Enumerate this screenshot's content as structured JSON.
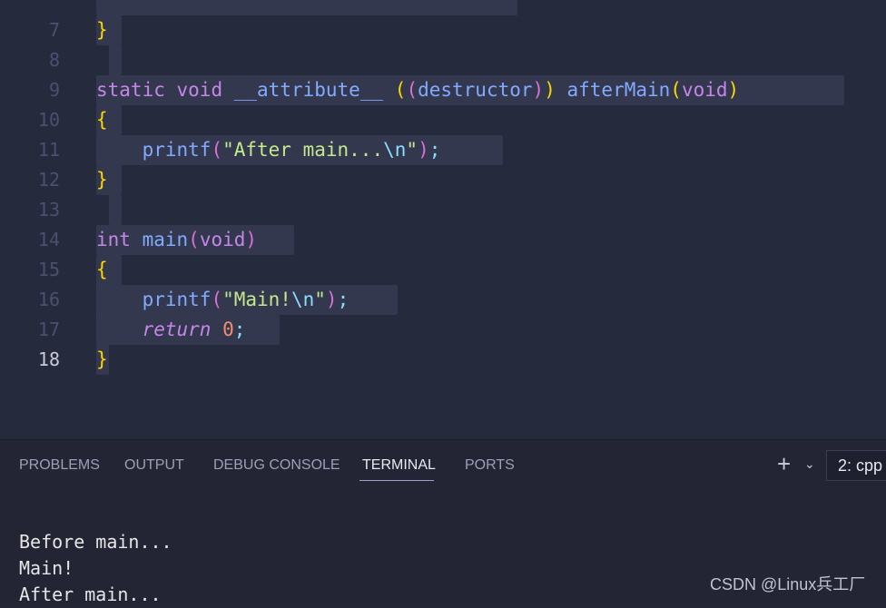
{
  "editor": {
    "lines": {
      "l7": "7",
      "l8": "8",
      "l9": "9",
      "l10": "10",
      "l11": "11",
      "l12": "12",
      "l13": "13",
      "l14": "14",
      "l15": "15",
      "l16": "16",
      "l17": "17",
      "l18": "18"
    },
    "code": {
      "static": "static",
      "void": "void",
      "attribute": "__attribute__",
      "destructor": "destructor",
      "afterMain": "afterMain",
      "printf": "printf",
      "after_str": "\"After main...",
      "newline": "\\n",
      "quote": "\"",
      "int": "int",
      "main": "main",
      "main_str": "\"Main!",
      "return": "return",
      "zero": "0",
      "open_brace": "{",
      "close_brace": "}"
    }
  },
  "panel": {
    "tabs": {
      "problems": "PROBLEMS",
      "output": "OUTPUT",
      "debug_console": "DEBUG CONSOLE",
      "terminal": "TERMINAL",
      "ports": "PORTS"
    },
    "terminal_selector": "2: cpp",
    "output_lines": [
      "Before main...",
      "Main!",
      "After main..."
    ]
  },
  "watermark": "CSDN @Linux兵工厂",
  "colors": {
    "editor_bg": "#262a3d",
    "panel_bg": "#232534",
    "keyword": "#c586e8",
    "function": "#82aaff",
    "string": "#c3e88d",
    "number": "#f78c6c",
    "bracket_gold": "#ffd700"
  },
  "icons": {
    "add_terminal": "plus-icon",
    "dropdown": "chevron-down-icon"
  }
}
